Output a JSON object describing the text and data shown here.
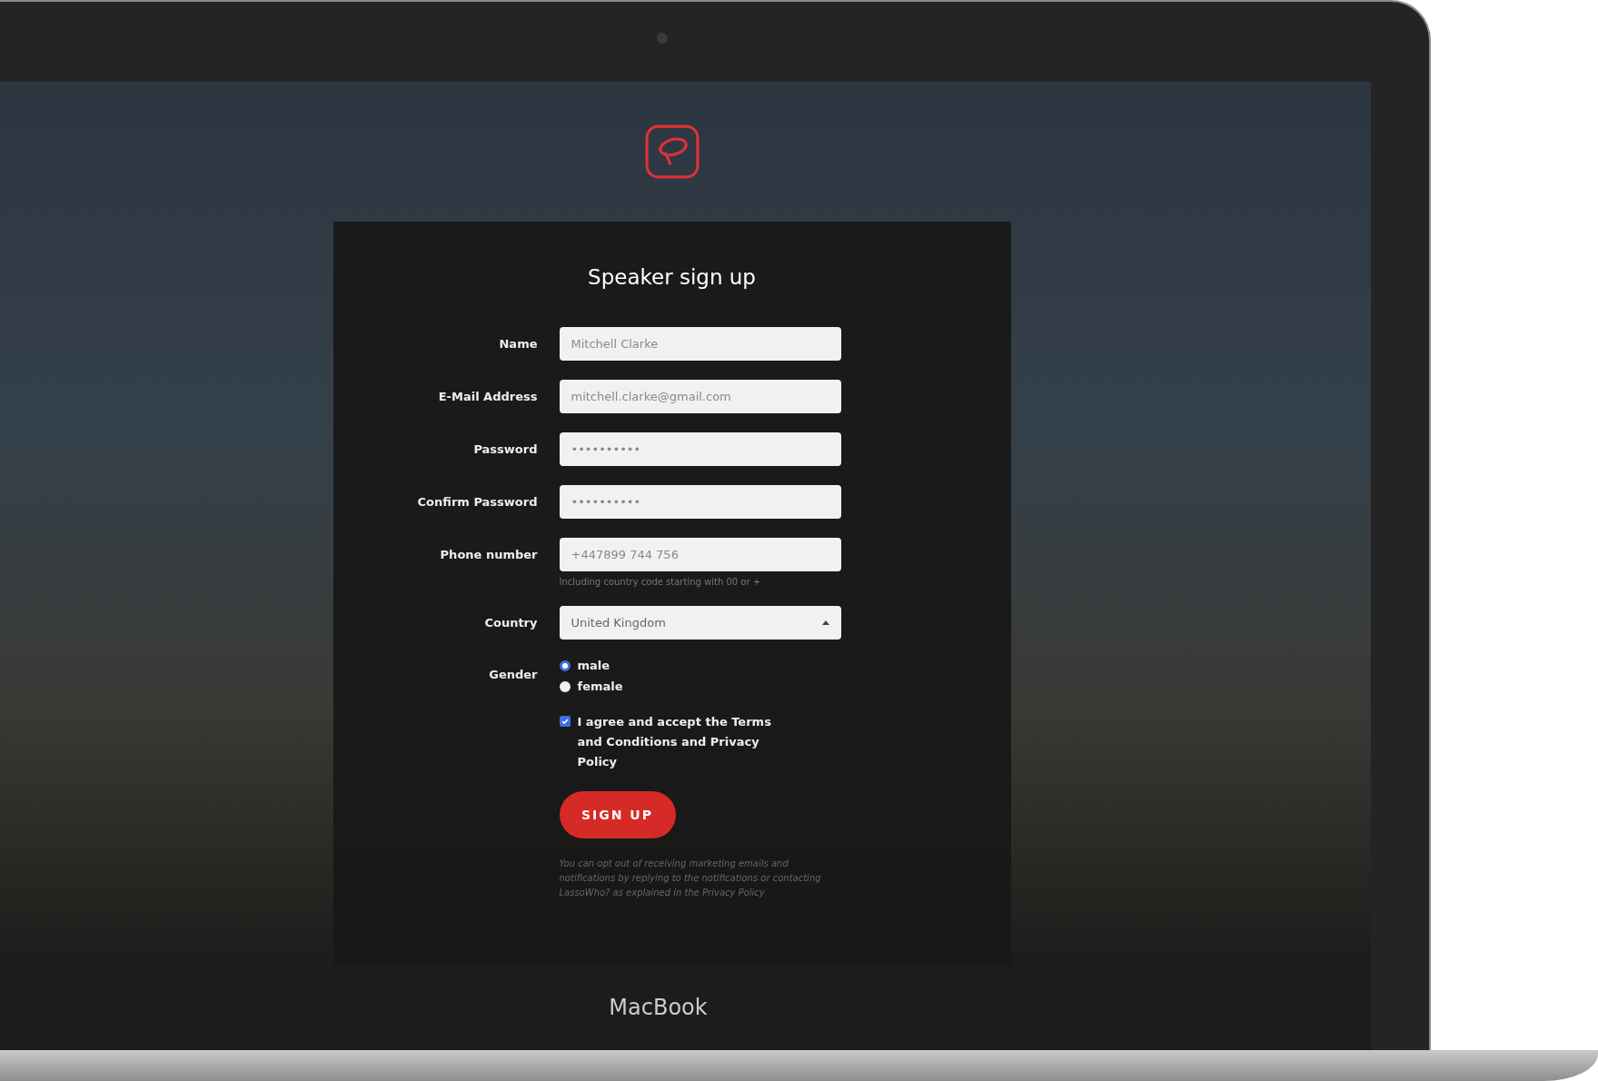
{
  "title": "Speaker sign up",
  "fields": [
    {
      "kind": "text",
      "label": "Name",
      "value": "Mitchell Clarke"
    },
    {
      "kind": "text",
      "label": "E-Mail Address",
      "value": "mitchell.clarke@gmail.com"
    },
    {
      "kind": "text",
      "label": "Password",
      "value": "••••••••••"
    },
    {
      "kind": "text",
      "label": "Confirm Password",
      "value": "••••••••••"
    },
    {
      "kind": "text",
      "label": "Phone number",
      "value": "+447899 744 756",
      "hint": "Including country code starting with 00 or +"
    },
    {
      "kind": "select",
      "label": "Country",
      "value": "United Kingdom"
    }
  ],
  "gender": {
    "label": "Gender",
    "options": [
      {
        "label": "male",
        "selected": true
      },
      {
        "label": "female",
        "selected": false
      }
    ]
  },
  "terms": {
    "text": "I agree and accept the Terms and Conditions and Privacy Policy",
    "checked": true
  },
  "submit": "SIGN UP",
  "fine_print": "You can opt out of receiving marketing emails and notifications by replying to the notifications or contacting LassoWho? as explained in the Privacy Policy",
  "device_label": "MacBook"
}
